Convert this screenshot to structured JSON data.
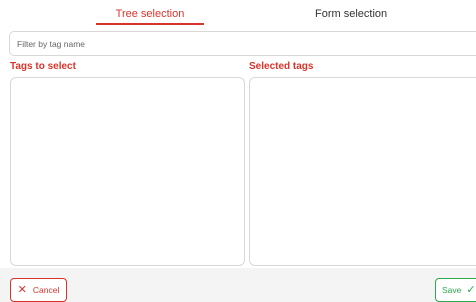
{
  "tabs": {
    "tree": "Tree selection",
    "form": "Form selection",
    "active": "tree"
  },
  "filter": {
    "placeholder": "Filter by tag name",
    "value": ""
  },
  "panels": {
    "left_title": "Tags to select",
    "right_title": "Selected tags"
  },
  "footer": {
    "cancel_label": "Cancel",
    "save_label": "Save",
    "cancel_icon": "close-icon",
    "save_icon": "check-icon"
  },
  "colors": {
    "accent": "#d9342b",
    "success": "#2fa84f"
  }
}
